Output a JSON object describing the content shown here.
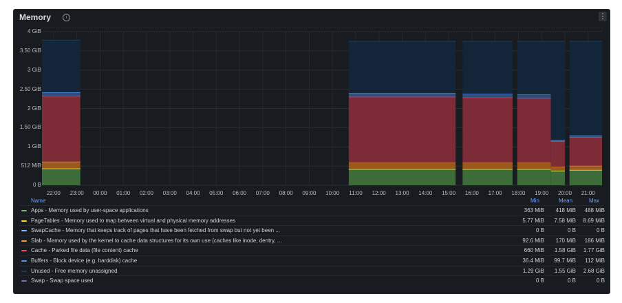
{
  "panel": {
    "title": "Memory",
    "info_icon": "info-circle-icon",
    "menu_icon": "kebab-menu-icon"
  },
  "chart_data": {
    "type": "area",
    "title": "Memory",
    "y_ticks": [
      "0 B",
      "512 MiB",
      "1 GiB",
      "1.50 GiB",
      "2 GiB",
      "2.50 GiB",
      "3 GiB",
      "3.50 GiB",
      "4 GiB"
    ],
    "ylim": [
      0,
      4096
    ],
    "y_unit": "MiB",
    "x_ticks": [
      "22:00",
      "23:00",
      "00:00",
      "01:00",
      "02:00",
      "03:00",
      "04:00",
      "05:00",
      "06:00",
      "07:00",
      "08:00",
      "09:00",
      "10:00",
      "11:00",
      "12:00",
      "13:00",
      "14:00",
      "15:00",
      "16:00",
      "17:00",
      "18:00",
      "19:00",
      "20:00",
      "21:00"
    ],
    "x_hours": [
      22,
      23,
      24,
      25,
      26,
      27,
      28,
      29,
      30,
      31,
      32,
      33,
      34,
      35,
      36,
      37,
      38,
      39,
      40,
      41,
      42,
      43,
      44,
      45
    ],
    "segments": [
      {
        "start": 21.5,
        "end": 23.15,
        "apps": 440,
        "pagetables": 8,
        "swapcache": 0,
        "slab": 180,
        "cache": 1750,
        "buffers": 100,
        "unused": 1390
      },
      {
        "start": 34.7,
        "end": 39.3,
        "apps": 420,
        "pagetables": 8,
        "swapcache": 0,
        "slab": 170,
        "cache": 1760,
        "buffers": 100,
        "unused": 1380
      },
      {
        "start": 39.6,
        "end": 41.75,
        "apps": 420,
        "pagetables": 8,
        "swapcache": 0,
        "slab": 170,
        "cache": 1740,
        "buffers": 100,
        "unused": 1400
      },
      {
        "start": 41.95,
        "end": 43.4,
        "apps": 420,
        "pagetables": 8,
        "swapcache": 0,
        "slab": 170,
        "cache": 1720,
        "buffers": 100,
        "unused": 1420
      },
      {
        "start": 43.4,
        "end": 44.0,
        "apps": 380,
        "pagetables": 8,
        "swapcache": 0,
        "slab": 100,
        "cache": 680,
        "buffers": 40,
        "unused": 2630
      },
      {
        "start": 44.2,
        "end": 45.6,
        "apps": 400,
        "pagetables": 8,
        "swapcache": 0,
        "slab": 110,
        "cache": 760,
        "buffers": 50,
        "unused": 2510
      }
    ],
    "series": [
      {
        "key": "apps",
        "name": "Apps - Memory used by user-space applications",
        "color": "#73bf69",
        "fill": "#3d6b3a",
        "min": "363 MiB",
        "mean": "418 MiB",
        "max": "488 MiB"
      },
      {
        "key": "pagetables",
        "name": "PageTables - Memory used to map between virtual and physical memory addresses",
        "color": "#fade2a",
        "fill": "#8a7a1a",
        "min": "5.77 MiB",
        "mean": "7.58 MiB",
        "max": "8.69 MiB"
      },
      {
        "key": "swapcache",
        "name": "SwapCache - Memory that keeps track of pages that have been fetched from swap but not yet been ...",
        "color": "#8ab8ff",
        "fill": "#405a85",
        "min": "0 B",
        "mean": "0 B",
        "max": "0 B"
      },
      {
        "key": "slab",
        "name": "Slab - Memory used by the kernel to cache data structures for its own use (caches like inode, dentry, ...",
        "color": "#ff9830",
        "fill": "#9a5a1e",
        "min": "92.6 MiB",
        "mean": "170 MiB",
        "max": "186 MiB"
      },
      {
        "key": "cache",
        "name": "Cache - Parked file data (file content) cache",
        "color": "#f2495c",
        "fill": "#7c2b37",
        "min": "660 MiB",
        "mean": "1.58 GiB",
        "max": "1.77 GiB"
      },
      {
        "key": "buffers",
        "name": "Buffers - Block device (e.g. harddisk) cache",
        "color": "#5794f2",
        "fill": "#2f4f80",
        "min": "36.4 MiB",
        "mean": "99.7 MiB",
        "max": "112 MiB"
      },
      {
        "key": "unused",
        "name": "Unused - Free memory unassigned",
        "color": "#1f3a59",
        "fill": "#132538",
        "min": "1.29 GiB",
        "mean": "1.55 GiB",
        "max": "2.68 GiB"
      },
      {
        "key": "swap",
        "name": "Swap - Swap space used",
        "color": "#806eb7",
        "fill": "#3d3560",
        "min": "0 B",
        "mean": "0 B",
        "max": "0 B"
      }
    ]
  },
  "legend": {
    "name_header": "Name",
    "min_header": "Min",
    "mean_header": "Mean",
    "max_header": "Max"
  }
}
